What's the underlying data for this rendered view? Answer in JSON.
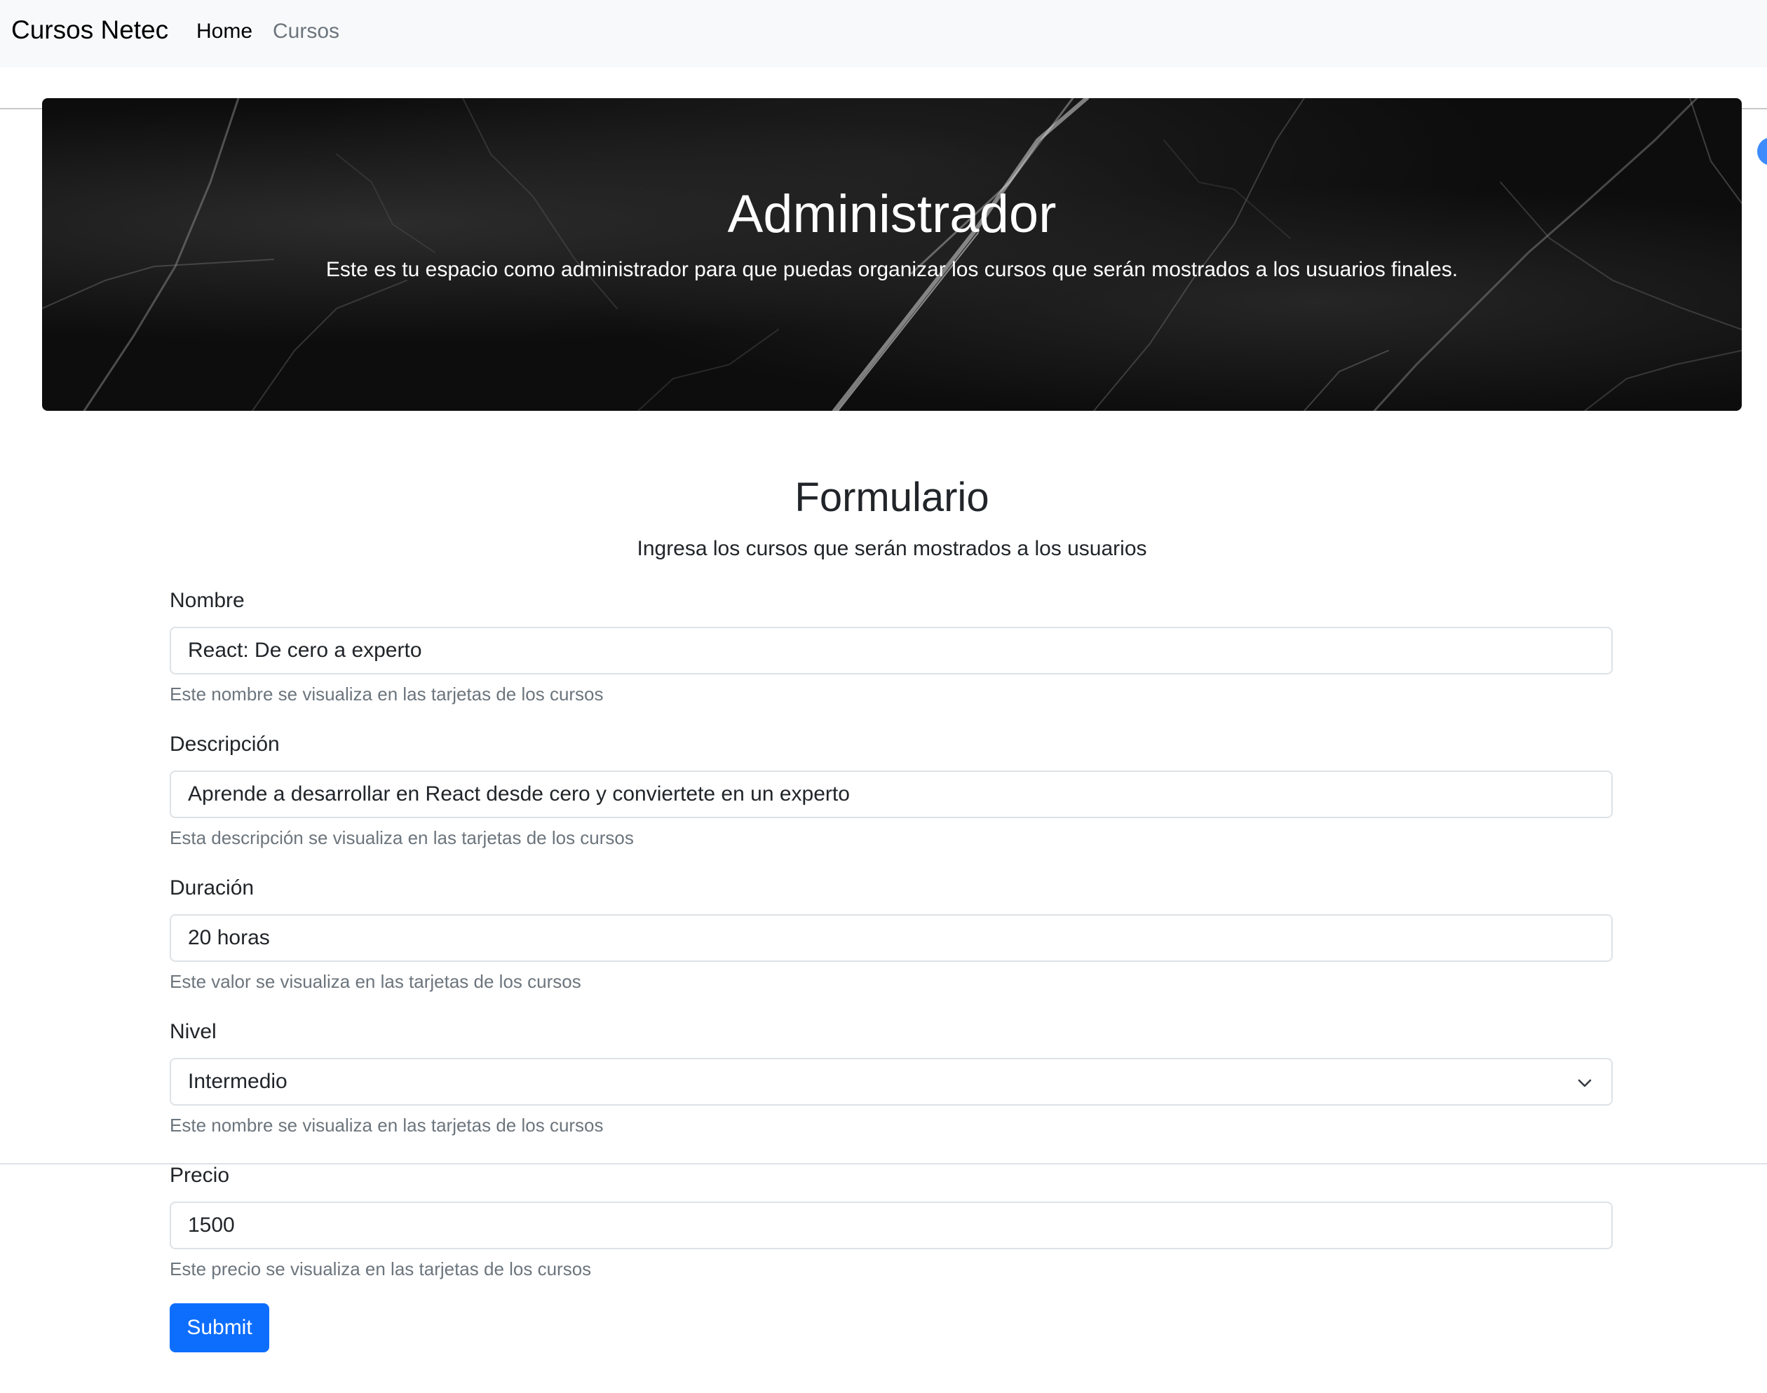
{
  "navbar": {
    "brand": "Cursos Netec",
    "links": [
      {
        "label": "Home",
        "active": true
      },
      {
        "label": "Cursos",
        "active": false
      }
    ]
  },
  "hero": {
    "title": "Administrador",
    "subtitle": "Este es tu espacio como administrador para que puedas organizar los cursos que serán mostrados a los usuarios finales."
  },
  "form": {
    "title": "Formulario",
    "subtitle": "Ingresa los cursos que serán mostrados a los usuarios",
    "fields": {
      "nombre": {
        "label": "Nombre",
        "value": "React: De cero a experto",
        "help": "Este nombre se visualiza en las tarjetas de los cursos"
      },
      "descripcion": {
        "label": "Descripción",
        "value": "Aprende a desarrollar en React desde cero y conviertete en un experto",
        "help": "Esta descripción se visualiza en las tarjetas de los cursos"
      },
      "duracion": {
        "label": "Duración",
        "value": "20 horas",
        "help": "Este valor se visualiza en las tarjetas de los cursos"
      },
      "nivel": {
        "label": "Nivel",
        "selected": "Intermedio",
        "help": "Este nombre se visualiza en las tarjetas de los cursos",
        "icon": "chevron-down-icon"
      },
      "precio": {
        "label": "Precio",
        "value": "1500",
        "help": "Este precio se visualiza en las tarjetas de los cursos"
      }
    },
    "submit_label": "Submit"
  },
  "colors": {
    "navbar_bg": "#f8f9fa",
    "primary": "#0d6efd",
    "muted_text": "#6c757d",
    "hero_bg": "#0d0d0d"
  }
}
